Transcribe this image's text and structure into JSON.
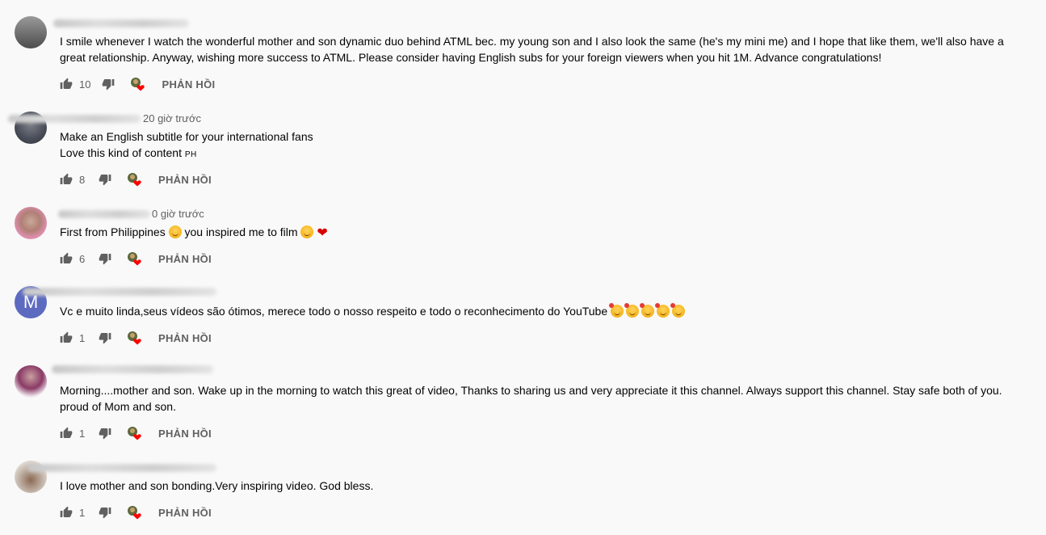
{
  "reply_label": "PHẢN HỒI",
  "comments": [
    {
      "avatar": "grey-photo",
      "time": "",
      "lines": [
        "I smile whenever I watch the wonderful mother and son dynamic duo behind ATML bec. my young son and I also look the same (he's my mini me) and I hope that like them, we'll also have a",
        "great relationship. Anyway, wishing more success to ATML. Please consider having English subs for your foreign viewers when you hit 1M. Advance congratulations!"
      ],
      "likes": "10"
    },
    {
      "avatar": "photo",
      "time": "20 giờ trước",
      "lines": [
        "Make an English subtitle for your international fans",
        "Love this kind of content"
      ],
      "line_suffix": "PH",
      "likes": "8"
    },
    {
      "avatar": "photo",
      "time": "0 giờ trước",
      "lines": [
        "First from Philippines",
        "you inspired me to film"
      ],
      "likes": "6"
    },
    {
      "avatar": "letter",
      "avatar_letter": "M",
      "avatar_color": "#5c6bc0",
      "time": "",
      "lines": [
        "Vc e muito linda,seus vídeos são ótimos, merece todo o nosso respeito e todo o reconhecimento do YouTube"
      ],
      "likes": "1"
    },
    {
      "avatar": "photo",
      "time": "",
      "lines": [
        "Morning....mother and son. Wake up in the morning to watch this great of video, Thanks to sharing us and very appreciate it this channel. Always support this channel. Stay safe both of you.",
        "proud of Mom and son."
      ],
      "likes": "1"
    },
    {
      "avatar": "photo",
      "time": "",
      "lines": [
        "I love mother and son bonding.Very inspiring video. God bless."
      ],
      "likes": "1"
    }
  ],
  "icons": {
    "like": "thumbs-up-icon",
    "dislike": "thumbs-down-icon",
    "creator_heart": "creator-heart-icon",
    "emoji": "smiling-face-emoji",
    "heart": "red-heart-emoji"
  },
  "colors": {
    "background": "#f9f9f9",
    "text": "#030303",
    "secondary": "#606060",
    "heart": "#ff0000",
    "avatar_letter_bg": "#5c6bc0"
  }
}
